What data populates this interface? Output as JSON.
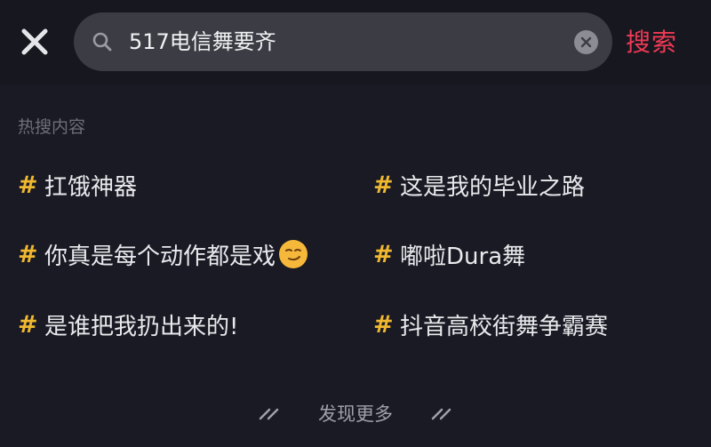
{
  "search": {
    "query": "517电信舞要齐",
    "submit_label": "搜索"
  },
  "hot": {
    "section_title": "热搜内容",
    "hash_symbol": "#",
    "topics": [
      {
        "text": "扛饿神器"
      },
      {
        "text": "这是我的毕业之路"
      },
      {
        "text": "你真是每个动作都是戏",
        "emoji": "smirk-emoji"
      },
      {
        "text": "嘟啦Dura舞"
      },
      {
        "text": "是谁把我扔出来的!"
      },
      {
        "text": "抖音高校街舞争霸赛"
      }
    ]
  },
  "footer": {
    "more_label": "发现更多"
  },
  "colors": {
    "background": "#1a1a24",
    "search_box": "#3c3c45",
    "accent_red": "#ee3a55",
    "hash_yellow": "#f0b830",
    "muted_text": "#6e6e78"
  }
}
